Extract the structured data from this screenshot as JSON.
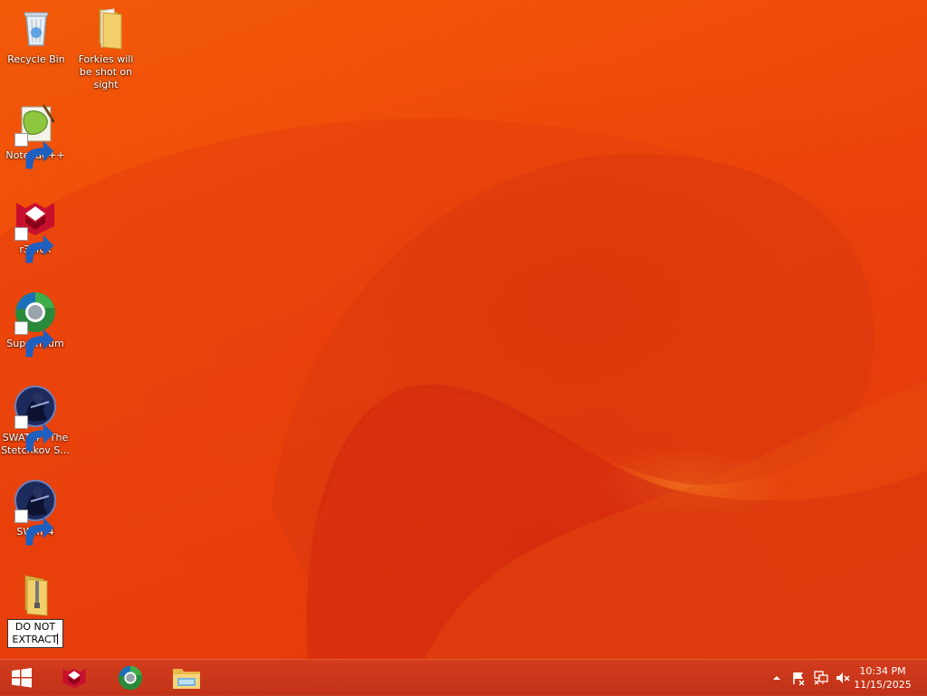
{
  "desktop": {
    "icons": [
      {
        "name": "recycle-bin",
        "label": "Recycle Bin",
        "icon": "recycle-bin-icon"
      },
      {
        "name": "folder-forkies",
        "label": "Forkies will be shot on sight",
        "icon": "folder-icon"
      },
      {
        "name": "notepadpp",
        "label": "Notepad++",
        "icon": "notepadpp-icon"
      },
      {
        "name": "r3dfox",
        "label": "r3dfox",
        "icon": "r3dfox-icon"
      },
      {
        "name": "supermium",
        "label": "Supermium",
        "icon": "supermium-icon"
      },
      {
        "name": "swat4-stetchkov",
        "label": "SWAT 4 - The Stetchkov S...",
        "icon": "swat4-icon"
      },
      {
        "name": "swat4",
        "label": "SWAT 4",
        "icon": "swat4-icon"
      },
      {
        "name": "zip-folder",
        "label": "DO NOT\nEXTRACT",
        "icon": "zip-folder-icon",
        "renaming": true
      }
    ]
  },
  "taskbar": {
    "start": "windows-logo-icon",
    "pinned": [
      "r3dfox-icon",
      "supermium-icon",
      "file-explorer-icon"
    ],
    "tray": [
      "show-hidden-icons-chevron",
      "action-center-flag-icon",
      "network-icon",
      "volume-muted-icon"
    ],
    "clock": {
      "time": "10:34 PM",
      "date": "11/15/2025"
    }
  },
  "colors": {
    "wallpaper_base": "#ef4a0a",
    "taskbar": "#c9401e",
    "label_text": "#ffffff"
  }
}
